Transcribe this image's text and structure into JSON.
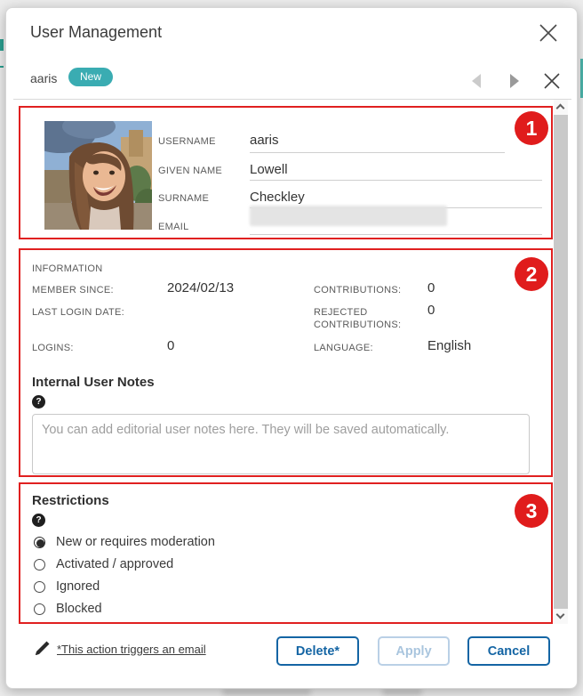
{
  "colors": {
    "accent_red": "#e02020",
    "badge_teal": "#3aacb2",
    "button_blue": "#1465a4"
  },
  "dialog": {
    "title": "User Management",
    "tab": {
      "username": "aaris",
      "badge": "New"
    }
  },
  "section1": {
    "number": "1",
    "fields": [
      {
        "label": "USERNAME",
        "value": "aaris"
      },
      {
        "label": "GIVEN NAME",
        "value": "Lowell"
      },
      {
        "label": "SURNAME",
        "value": "Checkley"
      },
      {
        "label": "EMAIL",
        "value": ""
      }
    ]
  },
  "section2": {
    "number": "2",
    "heading": "INFORMATION",
    "rows_left": [
      {
        "label": "MEMBER SINCE:",
        "value": "2024/02/13"
      },
      {
        "label": "LAST LOGIN DATE:",
        "value": ""
      },
      {
        "label": "LOGINS:",
        "value": "0"
      }
    ],
    "rows_right": [
      {
        "label": "CONTRIBUTIONS:",
        "value": "0"
      },
      {
        "label": "REJECTED CONTRIBUTIONS:",
        "value": "0"
      },
      {
        "label": "LANGUAGE:",
        "value": "English"
      }
    ],
    "notes_title": "Internal User Notes",
    "help_glyph": "?",
    "notes_placeholder": "You can add editorial user notes here. They will be saved automatically."
  },
  "section3": {
    "number": "3",
    "title": "Restrictions",
    "help_glyph": "?",
    "options": [
      {
        "label": "New or requires moderation",
        "selected": true
      },
      {
        "label": "Activated / approved",
        "selected": false
      },
      {
        "label": "Ignored",
        "selected": false
      },
      {
        "label": "Blocked",
        "selected": false
      }
    ]
  },
  "footer": {
    "note": "*This action triggers an email",
    "buttons": [
      {
        "label": "Delete*",
        "enabled": true
      },
      {
        "label": "Apply",
        "enabled": false
      },
      {
        "label": "Cancel",
        "enabled": true
      }
    ]
  }
}
